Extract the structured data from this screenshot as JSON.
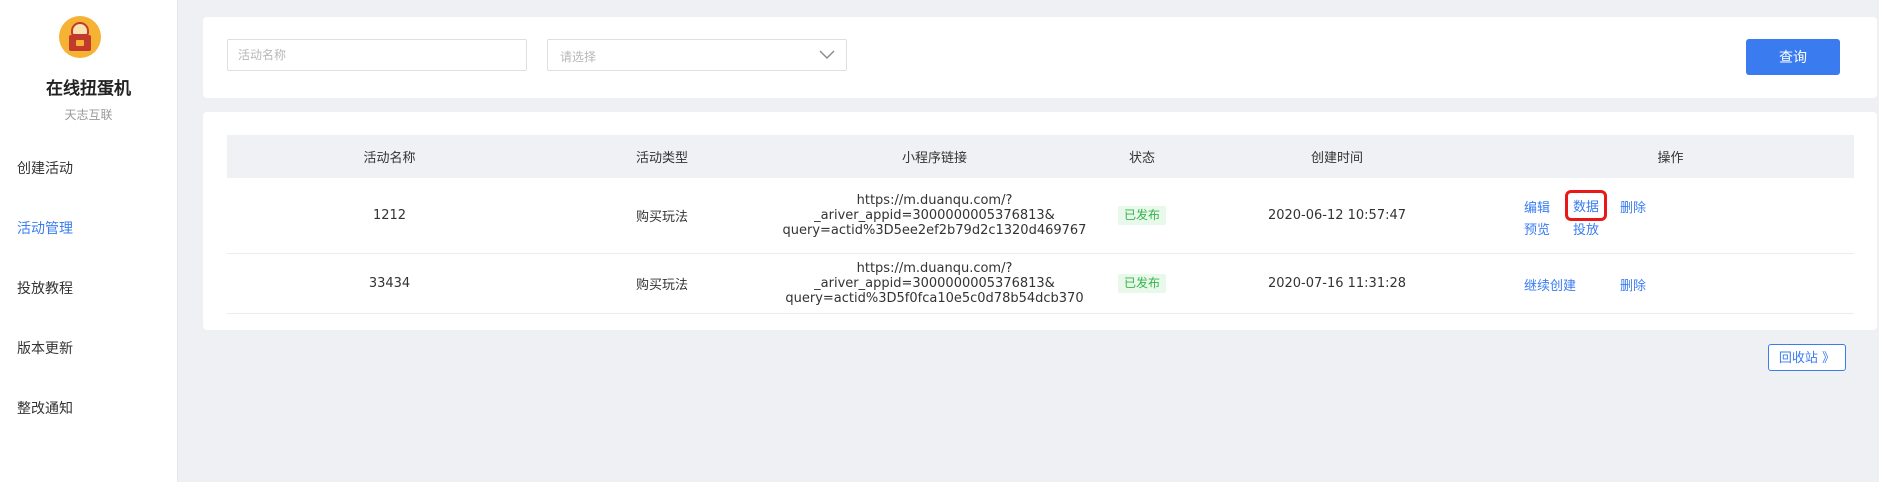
{
  "sidebar": {
    "app_name": "在线扭蛋机",
    "app_sub": "天志互联",
    "items": [
      {
        "label": "创建活动"
      },
      {
        "label": "活动管理",
        "active": true
      },
      {
        "label": "投放教程"
      },
      {
        "label": "版本更新"
      },
      {
        "label": "整改通知"
      }
    ]
  },
  "search": {
    "name_placeholder": "活动名称",
    "type_placeholder": "请选择",
    "query_label": "查询"
  },
  "table": {
    "headers": [
      "活动名称",
      "活动类型",
      "小程序链接",
      "状态",
      "创建时间",
      "操作"
    ],
    "rows": [
      {
        "name": "1212",
        "type": "购买玩法",
        "link_line1": "https://m.duanqu.com/?_ariver_appid=3000000005376813&",
        "link_line2": "query=actid%3D5ee2ef2b79d2c1320d469767",
        "status": "已发布",
        "created": "2020-06-12 10:57:47",
        "ops": {
          "edit": "编辑",
          "data": "数据",
          "delete": "删除",
          "preview": "预览",
          "launch": "投放"
        }
      },
      {
        "name": "33434",
        "type": "购买玩法",
        "link_line1": "https://m.duanqu.com/?_ariver_appid=3000000005376813&",
        "link_line2": "query=actid%3D5f0fca10e5c0d78b54dcb370",
        "status": "已发布",
        "created": "2020-07-16 11:31:28",
        "ops": {
          "continue": "继续创建",
          "delete": "删除"
        }
      }
    ]
  },
  "recycle_label": "回收站 》",
  "colors": {
    "primary": "#3a7cf0",
    "published_bg": "#e8f8ea",
    "published_text": "#35b44a",
    "highlight": "#e91818"
  }
}
